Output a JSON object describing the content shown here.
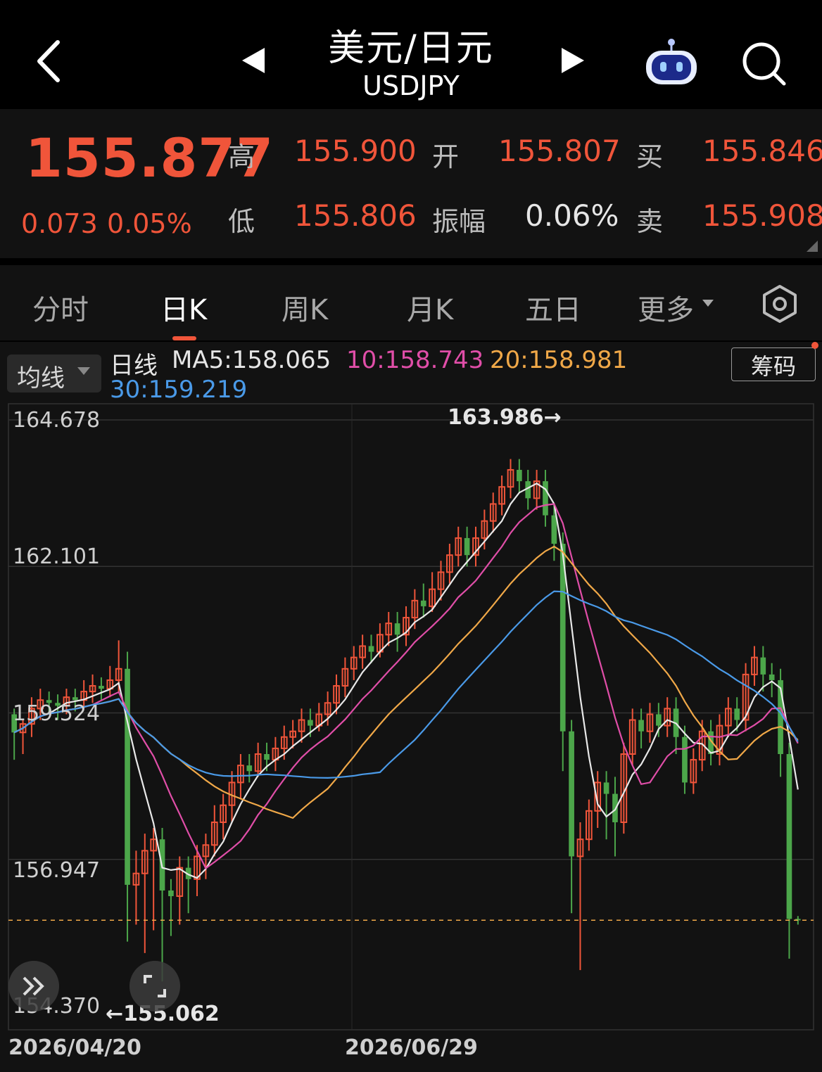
{
  "header": {
    "title": "美元/日元",
    "subtitle": "USDJPY",
    "back_icon": "chevron-left-icon",
    "prev_icon": "triangle-left-icon",
    "next_icon": "triangle-right-icon",
    "robot_icon": "assistant-robot-icon",
    "search_icon": "search-icon"
  },
  "quote": {
    "price": "155.877",
    "change": "0.073",
    "change_pct": "0.05%",
    "high_label": "高",
    "high": "155.900",
    "low_label": "低",
    "low": "155.806",
    "open_label": "开",
    "open": "155.807",
    "amp_label": "振幅",
    "amp": "0.06%",
    "buy_label": "买",
    "buy": "155.846",
    "sell_label": "卖",
    "sell": "155.908"
  },
  "tabs": [
    {
      "label": "分时"
    },
    {
      "label": "日K"
    },
    {
      "label": "周K"
    },
    {
      "label": "月K"
    },
    {
      "label": "五日"
    },
    {
      "label": "更多"
    }
  ],
  "settings_icon": "hexagon-settings-icon",
  "colors": {
    "up": "#f0553a",
    "down": "#4ca64a",
    "ma5": "#e8e8e8",
    "ma10": "#e04ea8",
    "ma20": "#f0a848",
    "ma30": "#4a9ae8"
  },
  "ma_legend": {
    "select_label": "均线",
    "period": "日线",
    "ma5": "MA5:158.065",
    "ma10": "10:158.743",
    "ma20": "20:158.981",
    "ma30": "30:159.219"
  },
  "chips_button": "筹码",
  "chart_data": {
    "type": "candlestick",
    "ylim": [
      154.37,
      164.678
    ],
    "y_ticks": [
      "164.678",
      "162.101",
      "159.524",
      "156.947",
      "154.370"
    ],
    "x_ticks": [
      "2026/04/20",
      "2026/06/29"
    ],
    "max_annotation": "163.986→",
    "min_annotation": "←155.062",
    "last_price": 155.877,
    "candles": [
      [
        159.5,
        159.18,
        159.6,
        158.7
      ],
      [
        159.18,
        159.33,
        159.4,
        158.8
      ],
      [
        159.33,
        159.6,
        159.8,
        159.1
      ],
      [
        159.6,
        159.75,
        159.95,
        159.4
      ],
      [
        159.75,
        159.7,
        159.9,
        159.5
      ],
      [
        159.7,
        159.65,
        159.85,
        159.4
      ],
      [
        159.65,
        159.8,
        159.95,
        159.5
      ],
      [
        159.8,
        159.75,
        159.95,
        159.55
      ],
      [
        159.75,
        159.9,
        160.1,
        159.6
      ],
      [
        159.9,
        160.0,
        160.2,
        159.7
      ],
      [
        160.0,
        159.95,
        160.15,
        159.75
      ],
      [
        159.95,
        160.1,
        160.35,
        159.8
      ],
      [
        160.1,
        160.3,
        160.8,
        159.9
      ],
      [
        160.3,
        156.5,
        160.6,
        155.5
      ],
      [
        156.5,
        156.7,
        157.1,
        155.8
      ],
      [
        156.7,
        157.1,
        157.4,
        155.3
      ],
      [
        157.1,
        157.3,
        157.5,
        155.7
      ],
      [
        157.3,
        156.4,
        157.5,
        154.8
      ],
      [
        156.4,
        156.3,
        156.6,
        155.6
      ],
      [
        156.3,
        156.8,
        157.0,
        155.8
      ],
      [
        156.8,
        156.6,
        157.0,
        156.0
      ],
      [
        156.6,
        157.0,
        157.2,
        156.3
      ],
      [
        157.0,
        157.2,
        157.4,
        156.6
      ],
      [
        157.2,
        157.6,
        157.9,
        157.0
      ],
      [
        157.6,
        157.9,
        158.1,
        157.3
      ],
      [
        157.9,
        158.3,
        158.5,
        157.6
      ],
      [
        158.3,
        158.6,
        158.8,
        158.0
      ],
      [
        158.6,
        158.5,
        158.8,
        158.3
      ],
      [
        158.5,
        158.8,
        159.0,
        158.4
      ],
      [
        158.8,
        158.7,
        159.0,
        158.5
      ],
      [
        158.7,
        158.9,
        159.1,
        158.5
      ],
      [
        158.9,
        159.1,
        159.3,
        158.7
      ],
      [
        159.1,
        159.2,
        159.4,
        158.9
      ],
      [
        159.2,
        159.4,
        159.6,
        159.0
      ],
      [
        159.4,
        159.3,
        159.6,
        159.1
      ],
      [
        159.3,
        159.5,
        159.7,
        159.2
      ],
      [
        159.5,
        159.7,
        159.9,
        159.3
      ],
      [
        159.7,
        160.0,
        160.2,
        159.5
      ],
      [
        160.0,
        160.3,
        160.5,
        159.8
      ],
      [
        160.3,
        160.5,
        160.7,
        160.1
      ],
      [
        160.5,
        160.7,
        160.9,
        160.3
      ],
      [
        160.7,
        160.6,
        160.9,
        160.4
      ],
      [
        160.6,
        160.9,
        161.1,
        160.5
      ],
      [
        160.9,
        161.1,
        161.3,
        160.7
      ],
      [
        161.1,
        160.9,
        161.3,
        160.6
      ],
      [
        160.9,
        161.2,
        161.4,
        160.7
      ],
      [
        161.2,
        161.5,
        161.7,
        161.0
      ],
      [
        161.5,
        161.4,
        161.8,
        161.2
      ],
      [
        161.4,
        161.7,
        162.0,
        161.3
      ],
      [
        161.7,
        162.0,
        162.2,
        161.5
      ],
      [
        162.0,
        162.3,
        162.5,
        161.8
      ],
      [
        162.3,
        162.6,
        162.8,
        162.1
      ],
      [
        162.6,
        162.3,
        162.8,
        162.1
      ],
      [
        162.3,
        162.6,
        162.8,
        162.1
      ],
      [
        162.6,
        162.9,
        163.1,
        162.4
      ],
      [
        162.9,
        163.2,
        163.4,
        162.7
      ],
      [
        163.2,
        163.5,
        163.7,
        163.0
      ],
      [
        163.5,
        163.8,
        163.99,
        163.3
      ],
      [
        163.8,
        163.6,
        163.99,
        163.4
      ],
      [
        163.6,
        163.3,
        163.8,
        163.1
      ],
      [
        163.3,
        163.6,
        163.8,
        163.1
      ],
      [
        163.6,
        163.0,
        163.8,
        162.8
      ],
      [
        163.0,
        162.5,
        163.2,
        162.2
      ],
      [
        162.5,
        159.2,
        162.7,
        158.5
      ],
      [
        159.2,
        157.0,
        159.4,
        156.0
      ],
      [
        157.0,
        157.3,
        157.6,
        155.0
      ],
      [
        157.3,
        157.8,
        158.0,
        157.1
      ],
      [
        157.8,
        158.3,
        158.5,
        157.5
      ],
      [
        158.3,
        158.1,
        158.5,
        157.3
      ],
      [
        158.1,
        157.6,
        158.4,
        157.0
      ],
      [
        157.6,
        158.8,
        159.0,
        157.4
      ],
      [
        158.8,
        159.4,
        159.6,
        158.6
      ],
      [
        159.4,
        159.2,
        159.6,
        158.9
      ],
      [
        159.2,
        159.5,
        159.7,
        159.0
      ],
      [
        159.5,
        159.3,
        159.7,
        159.1
      ],
      [
        159.3,
        159.6,
        159.8,
        159.1
      ],
      [
        159.6,
        159.1,
        159.8,
        158.8
      ],
      [
        159.1,
        158.3,
        159.3,
        158.1
      ],
      [
        158.3,
        158.7,
        158.9,
        158.1
      ],
      [
        158.7,
        159.2,
        159.4,
        158.5
      ],
      [
        159.2,
        158.8,
        159.4,
        158.6
      ],
      [
        158.8,
        159.3,
        159.5,
        158.6
      ],
      [
        159.3,
        159.6,
        159.8,
        159.1
      ],
      [
        159.6,
        159.4,
        159.8,
        159.2
      ],
      [
        159.4,
        160.2,
        160.4,
        159.2
      ],
      [
        160.2,
        160.5,
        160.7,
        160.0
      ],
      [
        160.5,
        160.2,
        160.7,
        159.9
      ],
      [
        160.2,
        160.1,
        160.4,
        159.8
      ],
      [
        160.1,
        158.8,
        160.3,
        158.4
      ],
      [
        158.8,
        155.9,
        159.0,
        155.2
      ],
      [
        155.9,
        155.88,
        155.95,
        155.8
      ]
    ]
  }
}
